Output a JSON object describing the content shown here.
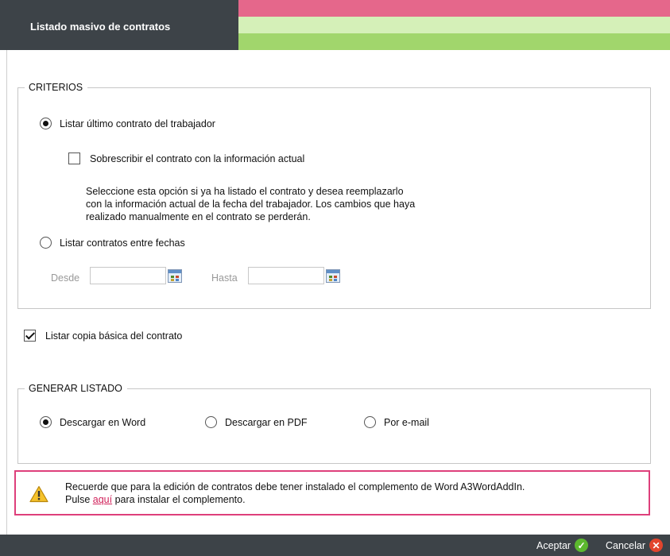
{
  "window": {
    "title": "Listado masivo de contratos"
  },
  "colors": {
    "header_dark": "#3d4348",
    "stripe_pink": "#e5678b",
    "stripe_light_green": "#d5f0b8",
    "stripe_green": "#a1d66c",
    "warning_border": "#de3f7b",
    "link": "#d1215a"
  },
  "criterios": {
    "legend": "CRITERIOS",
    "option_last": {
      "label": "Listar último contrato del trabajador",
      "selected": true
    },
    "overwrite": {
      "label": "Sobrescribir el contrato con la información actual",
      "checked": false
    },
    "description_lines": [
      "Seleccione esta opción si ya ha listado el contrato y desea reemplazarlo",
      "con la información actual de la fecha del trabajador. Los cambios que haya",
      "realizado manualmente en el contrato se perderán."
    ],
    "option_range": {
      "label": "Listar contratos entre fechas",
      "selected": false
    },
    "desde": {
      "label": "Desde",
      "value": ""
    },
    "hasta": {
      "label": "Hasta",
      "value": ""
    }
  },
  "basic_copy": {
    "label": "Listar copia básica del contrato",
    "checked": true
  },
  "generar": {
    "legend": "GENERAR LISTADO",
    "options": [
      {
        "label": "Descargar en Word",
        "selected": true
      },
      {
        "label": "Descargar en PDF",
        "selected": false
      },
      {
        "label": "Por e-mail",
        "selected": false
      }
    ]
  },
  "warning": {
    "icon": "warning-triangle-icon",
    "line1": "Recuerde que para la edición de contratos debe tener instalado el complemento de Word A3WordAddIn.",
    "line2_before": "Pulse ",
    "line2_link": "aquí",
    "line2_after": " para instalar el complemento."
  },
  "footer": {
    "accept_label": "Aceptar",
    "accept_icon": "check-circle-icon",
    "cancel_label": "Cancelar",
    "cancel_icon": "close-circle-icon"
  }
}
